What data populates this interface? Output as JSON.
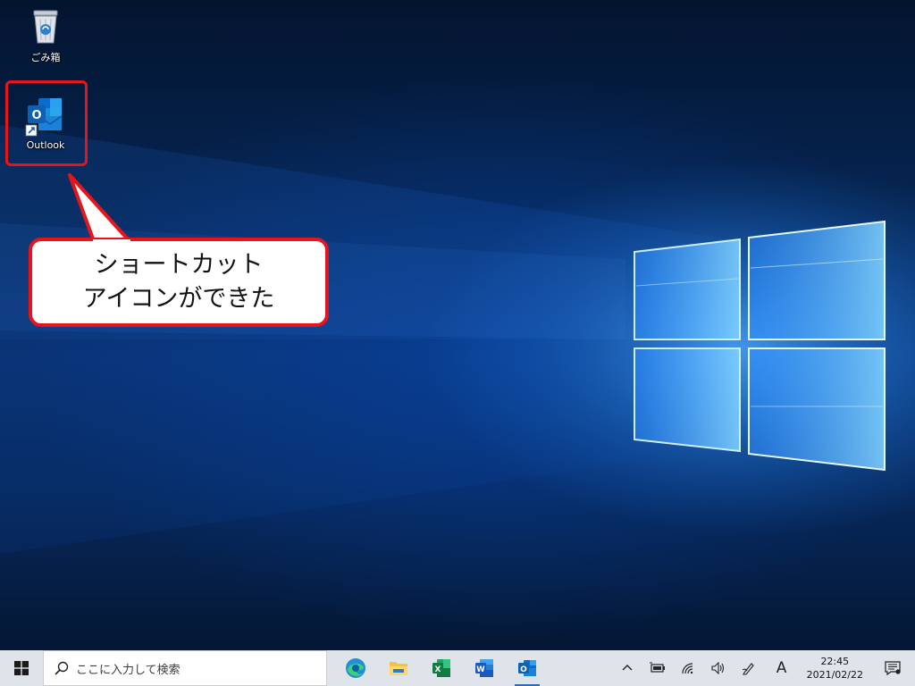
{
  "desktop": {
    "icons": [
      {
        "label": "ごみ箱",
        "icon": "recycle-bin-icon"
      },
      {
        "label": "Outlook",
        "icon": "outlook-shortcut-icon"
      }
    ]
  },
  "annotation": {
    "line1": "ショートカット",
    "line2": "アイコンができた",
    "color": "#e8141b"
  },
  "taskbar": {
    "search_placeholder": "ここに入力して検索",
    "apps": [
      "edge-icon",
      "file-explorer-icon",
      "excel-icon",
      "word-icon",
      "outlook-icon"
    ],
    "tray": {
      "ime": "A",
      "time": "22:45",
      "date": "2021/02/22"
    }
  }
}
